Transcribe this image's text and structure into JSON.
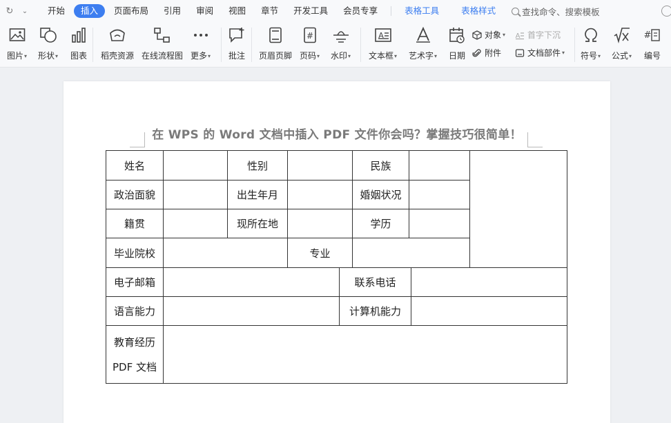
{
  "tabs": {
    "home": "开始",
    "insert": "插入",
    "page_layout": "页面布局",
    "reference": "引用",
    "review": "审阅",
    "view": "视图",
    "chapter": "章节",
    "developer": "开发工具",
    "member": "会员专享",
    "table_tools": "表格工具",
    "table_style": "表格样式"
  },
  "search": {
    "placeholder": "查找命令、搜索模板"
  },
  "ribbon": {
    "picture": "图片",
    "shape": "形状",
    "chart": "图表",
    "docer_resources": "稻壳资源",
    "online_flowchart": "在线流程图",
    "more": "更多",
    "comment": "批注",
    "header_footer": "页眉页脚",
    "page_number": "页码",
    "watermark": "水印",
    "textbox": "文本框",
    "wordart": "艺术字",
    "date": "日期",
    "object": "对象",
    "attachment": "附件",
    "drop_cap": "首字下沉",
    "doc_parts": "文档部件",
    "symbol": "符号",
    "formula": "公式",
    "numbering": "编号"
  },
  "document": {
    "title": "在 WPS 的 Word 文档中插入 PDF 文件你会吗？掌握技巧很简单！",
    "form": {
      "name": "姓名",
      "gender": "性别",
      "ethnicity": "民族",
      "political_status": "政治面貌",
      "birth_date": "出生年月",
      "marital_status": "婚姻状况",
      "native_place": "籍贯",
      "current_residence": "现所在地",
      "education_level": "学历",
      "school": "毕业院校",
      "major": "专业",
      "email": "电子邮箱",
      "phone": "联系电话",
      "language": "语言能力",
      "computer": "计算机能力",
      "education_history": "教育经历",
      "pdf_document": "PDF 文档"
    }
  }
}
